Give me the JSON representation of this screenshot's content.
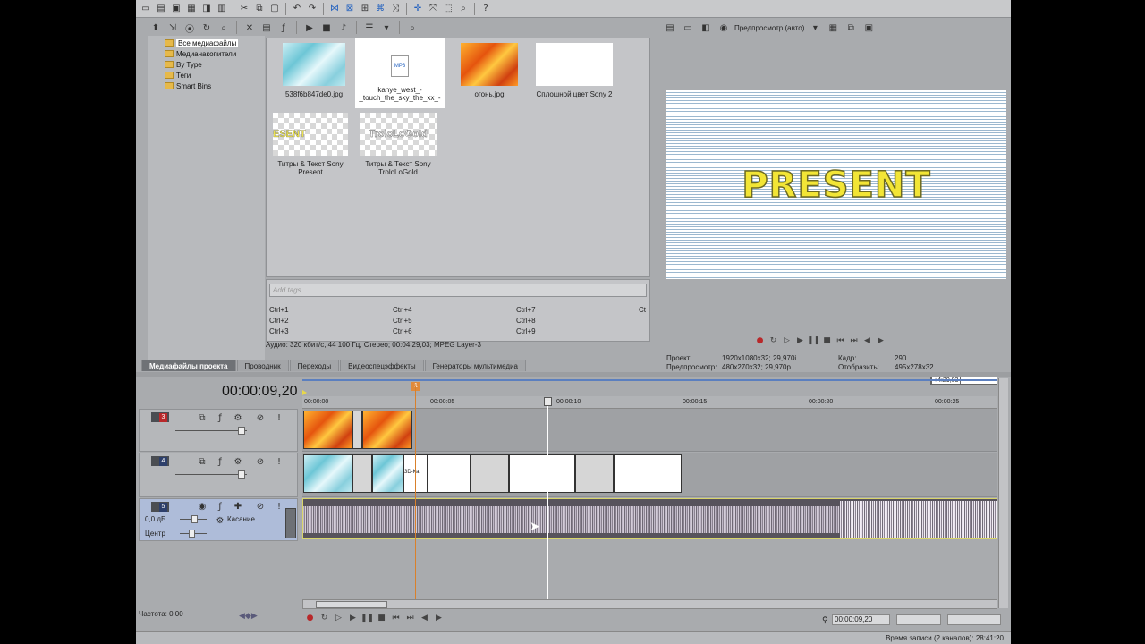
{
  "explorer": {
    "tree": [
      "Все медиафайлы",
      "Медианакопители",
      "By Type",
      "Теги",
      "Smart Bins"
    ],
    "media": [
      {
        "name": "538f6b847de0.jpg",
        "kind": "ice"
      },
      {
        "name": "kanye_west_-_touch_the_sky_the_xx_-_intro_i...",
        "kind": "mp3",
        "badge": "MP3"
      },
      {
        "name": "огонь.jpg",
        "kind": "fire"
      },
      {
        "name": "Сплошной цвет Sony 2",
        "kind": "white"
      },
      {
        "name": "Титры & Текст Sony Present",
        "kind": "title",
        "text": "ESENT"
      },
      {
        "name": "Титры & Текст Sony TroloLoGold",
        "kind": "title",
        "text": "TroloLoGold"
      }
    ],
    "tags_placeholder": "Add tags",
    "shortcuts": [
      [
        "Ctrl+1",
        "Ctrl+4",
        "Ctrl+7",
        "Ct"
      ],
      [
        "Ctrl+2",
        "Ctrl+5",
        "Ctrl+8",
        ""
      ],
      [
        "Ctrl+3",
        "Ctrl+6",
        "Ctrl+9",
        ""
      ]
    ],
    "info": "Аудио: 320 кбит/с, 44 100 Гц, Стерео; 00:04:29,03; MPEG Layer-3",
    "tabs": [
      "Медиафайлы проекта",
      "Проводник",
      "Переходы",
      "Видеоспецэффекты",
      "Генераторы мультимедиа"
    ]
  },
  "preview": {
    "mode": "Предпросмотр (авто)",
    "text": "PRESENT",
    "project_label": "Проект:",
    "project_value": "1920x1080x32; 29,970i",
    "preview_label": "Предпросмотр:",
    "preview_value": "480x270x32; 29,970p",
    "frame_label": "Кадр:",
    "frame_value": "290",
    "display_label": "Отобразить:",
    "display_value": "495x278x32"
  },
  "timeline": {
    "timecode": "00:00:09,20",
    "ruler": [
      "00:00:00",
      "00:00:05",
      "00:00:10",
      "00:00:15",
      "00:00:20",
      "00:00:25"
    ],
    "end_marker": "+4:29,03",
    "marker": "1",
    "tracks": [
      {
        "num": "3"
      },
      {
        "num": "4"
      },
      {
        "num": "5",
        "volume": "0,0 дБ",
        "mode": "Касание",
        "pan": "Центр"
      }
    ],
    "transition_label": "3D-Ка",
    "rate": "Частота: 0,00",
    "bottom_timecode": "00:00:09,20",
    "status": "Время записи (2 каналов): 28:41:20"
  },
  "colors": {
    "accent": "#1f5fbf",
    "record": "#b8282a",
    "audio_border": "#d8d56a",
    "title_yellow": "#f2e536"
  }
}
